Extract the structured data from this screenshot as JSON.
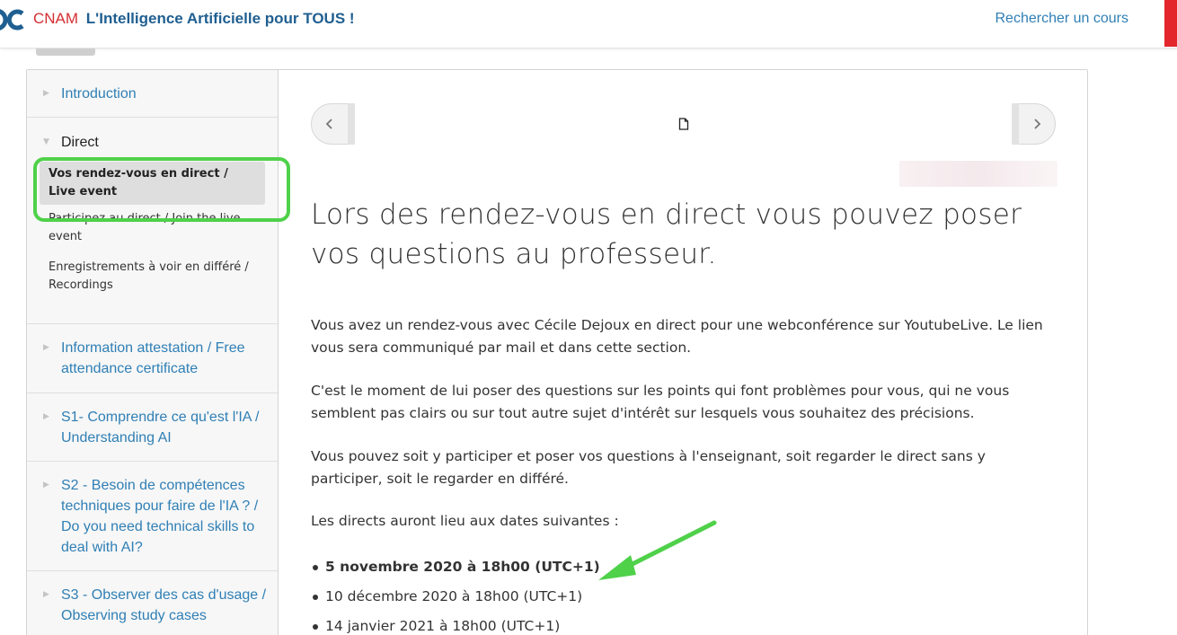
{
  "header": {
    "brand_abbrev": "CNAM",
    "brand_title": "L'Intelligence Artificielle pour TOUS !",
    "search_link": "Rechercher un cours"
  },
  "sidebar": {
    "sections": [
      {
        "label": "Introduction",
        "expanded": false
      },
      {
        "label": "Direct",
        "expanded": true,
        "items": [
          {
            "label": "Vos rendez-vous en direct / Live event",
            "active": true
          },
          {
            "label": "Participez au direct / Join the live event",
            "active": false
          },
          {
            "label": "Enregistrements à voir en différé / Recordings",
            "active": false
          }
        ]
      },
      {
        "label": "Information attestation / Free attendance certificate",
        "expanded": false
      },
      {
        "label": "S1- Comprendre ce qu'est l'IA / Understanding AI",
        "expanded": false
      },
      {
        "label": "S2 - Besoin de compétences techniques pour faire de l'IA ? / Do you need technical skills to deal with AI?",
        "expanded": false
      },
      {
        "label": "S3 - Observer des cas d'usage / Observing study cases",
        "expanded": false
      }
    ]
  },
  "main": {
    "title": "Lors des rendez-vous en direct vous pouvez poser vos questions au professeur.",
    "paragraphs": [
      "Vous avez un rendez-vous avec Cécile Dejoux en direct pour une webconférence sur YoutubeLive. Le lien vous sera communiqué par mail et dans cette section.",
      "C'est le moment de lui poser des questions sur les points qui font problèmes pour vous, qui ne vous semblent pas clairs ou sur tout autre sujet d'intérêt sur lesquels vous souhaitez des précisions.",
      "Vous pouvez soit y participer et poser vos questions à l'enseignant, soit regarder le direct sans y participer, soit le regarder en différé.",
      "Les directs auront lieu aux dates suivantes :"
    ],
    "dates": [
      "5 novembre 2020 à 18h00 (UTC+1)",
      "10 décembre 2020 à 18h00 (UTC+1)",
      "14 janvier 2021 à 18h00 (UTC+1)"
    ]
  },
  "colors": {
    "brand_red": "#d42f33",
    "brand_blue": "#1f5f91",
    "link_blue": "#2f7fb5",
    "highlight_green": "#4fd14a"
  },
  "icons": {
    "nav_prev": "chevron-left-icon",
    "nav_next": "chevron-right-icon",
    "nav_page": "document-icon"
  }
}
